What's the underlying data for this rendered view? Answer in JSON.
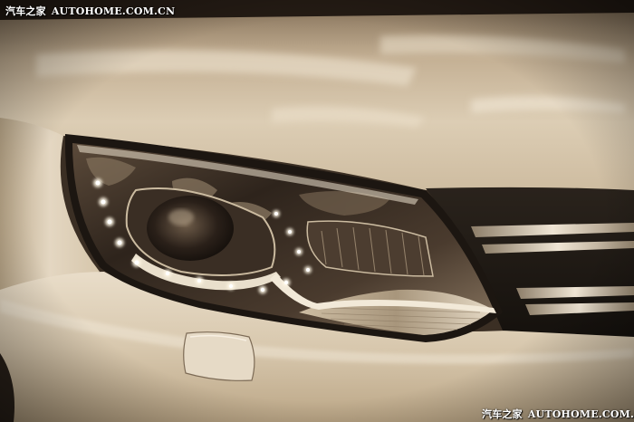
{
  "watermark_top": {
    "brand_cn": "汽车之家",
    "site": "AUTOHOME.COM.CN"
  },
  "watermark_bottom": {
    "brand_cn": "汽车之家",
    "site": "AUTOHOME.COM.CN"
  },
  "colors": {
    "paint_light": "#e8dcc8",
    "paint_mid": "#c9b79c",
    "paint_shadow": "#6f5e4a",
    "lens_dark": "#2a211a",
    "drl_led": "#fff8e6",
    "grille_dark": "#1e1914",
    "chrome": "#d9cdb8"
  },
  "icons": {
    "headlight": "headlight-assembly",
    "grille": "front-grille",
    "washer_cover": "headlamp-washer-cover"
  }
}
